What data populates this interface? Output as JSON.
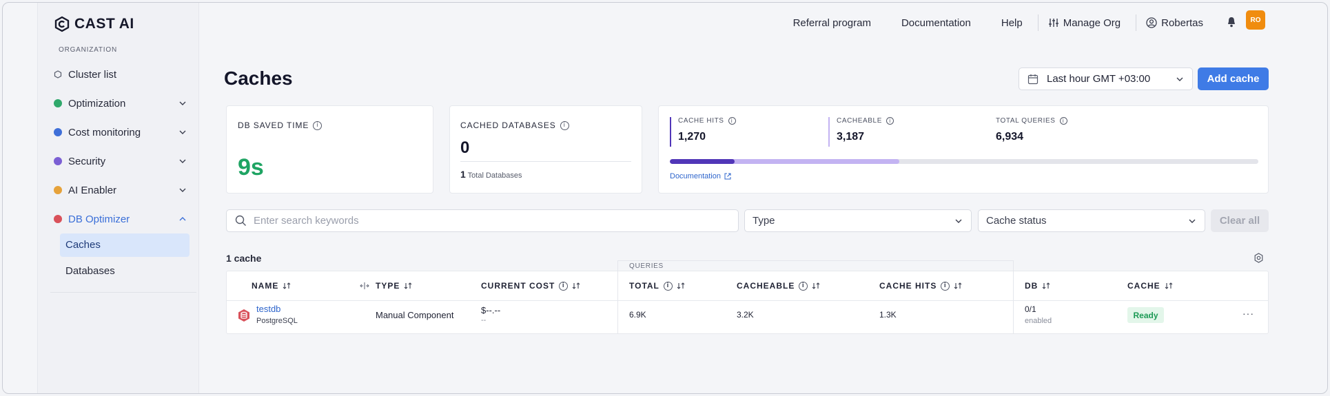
{
  "brand": {
    "name": "CAST AI"
  },
  "sidebar": {
    "org_label": "ORGANIZATION",
    "items": [
      {
        "label": "Cluster list",
        "icon": "hexagon-outline-icon",
        "color": "#555a69"
      },
      {
        "label": "Optimization",
        "icon": "optimization-icon",
        "color": "#2fa86b"
      },
      {
        "label": "Cost monitoring",
        "icon": "cost-monitoring-icon",
        "color": "#3f6fd8"
      },
      {
        "label": "Security",
        "icon": "security-icon",
        "color": "#7b5fd4"
      },
      {
        "label": "AI Enabler",
        "icon": "ai-enabler-icon",
        "color": "#e6a23a"
      },
      {
        "label": "DB Optimizer",
        "icon": "db-optimizer-icon",
        "color": "#d9515a"
      }
    ],
    "sub_items": [
      {
        "label": "Caches"
      },
      {
        "label": "Databases"
      }
    ]
  },
  "topbar": {
    "referral": "Referral program",
    "documentation": "Documentation",
    "help": "Help",
    "manage_org": "Manage Org",
    "user": "Robertas",
    "avatar_initials": "RO",
    "avatar_color": "#f08c0f"
  },
  "page": {
    "title": "Caches",
    "time_range": "Last hour GMT +03:00",
    "add_button": "Add cache"
  },
  "cards": {
    "saved_time": {
      "label": "DB SAVED TIME",
      "value": "9s"
    },
    "cached_dbs": {
      "label": "CACHED DATABASES",
      "value": "0",
      "total_count": "1",
      "total_label": "Total Databases"
    },
    "queries": {
      "hits_label": "CACHE HITS",
      "hits_value": "1,270",
      "cacheable_label": "CACHEABLE",
      "cacheable_value": "3,187",
      "total_label": "TOTAL QUERIES",
      "total_value": "6,934",
      "hits_fraction": 0.11,
      "cacheable_fraction": 0.39,
      "doc_link": "Documentation"
    }
  },
  "filters": {
    "search_placeholder": "Enter search keywords",
    "type_placeholder": "Type",
    "status_placeholder": "Cache status",
    "clear_label": "Clear all"
  },
  "table": {
    "count_label": "1 cache",
    "group_label": "QUERIES",
    "columns": {
      "name": "NAME",
      "type": "TYPE",
      "cost": "CURRENT COST",
      "total": "TOTAL",
      "cacheable": "CACHEABLE",
      "hits": "CACHE HITS",
      "db": "DB",
      "cache": "CACHE"
    },
    "rows": [
      {
        "name": "testdb",
        "engine": "PostgreSQL",
        "type": "Manual Component",
        "cost": "$--.--",
        "cost_sub": "--",
        "total": "6.9K",
        "cacheable": "3.2K",
        "hits": "1.3K",
        "db": "0/1",
        "db_sub": "enabled",
        "cache": "Ready"
      }
    ]
  }
}
